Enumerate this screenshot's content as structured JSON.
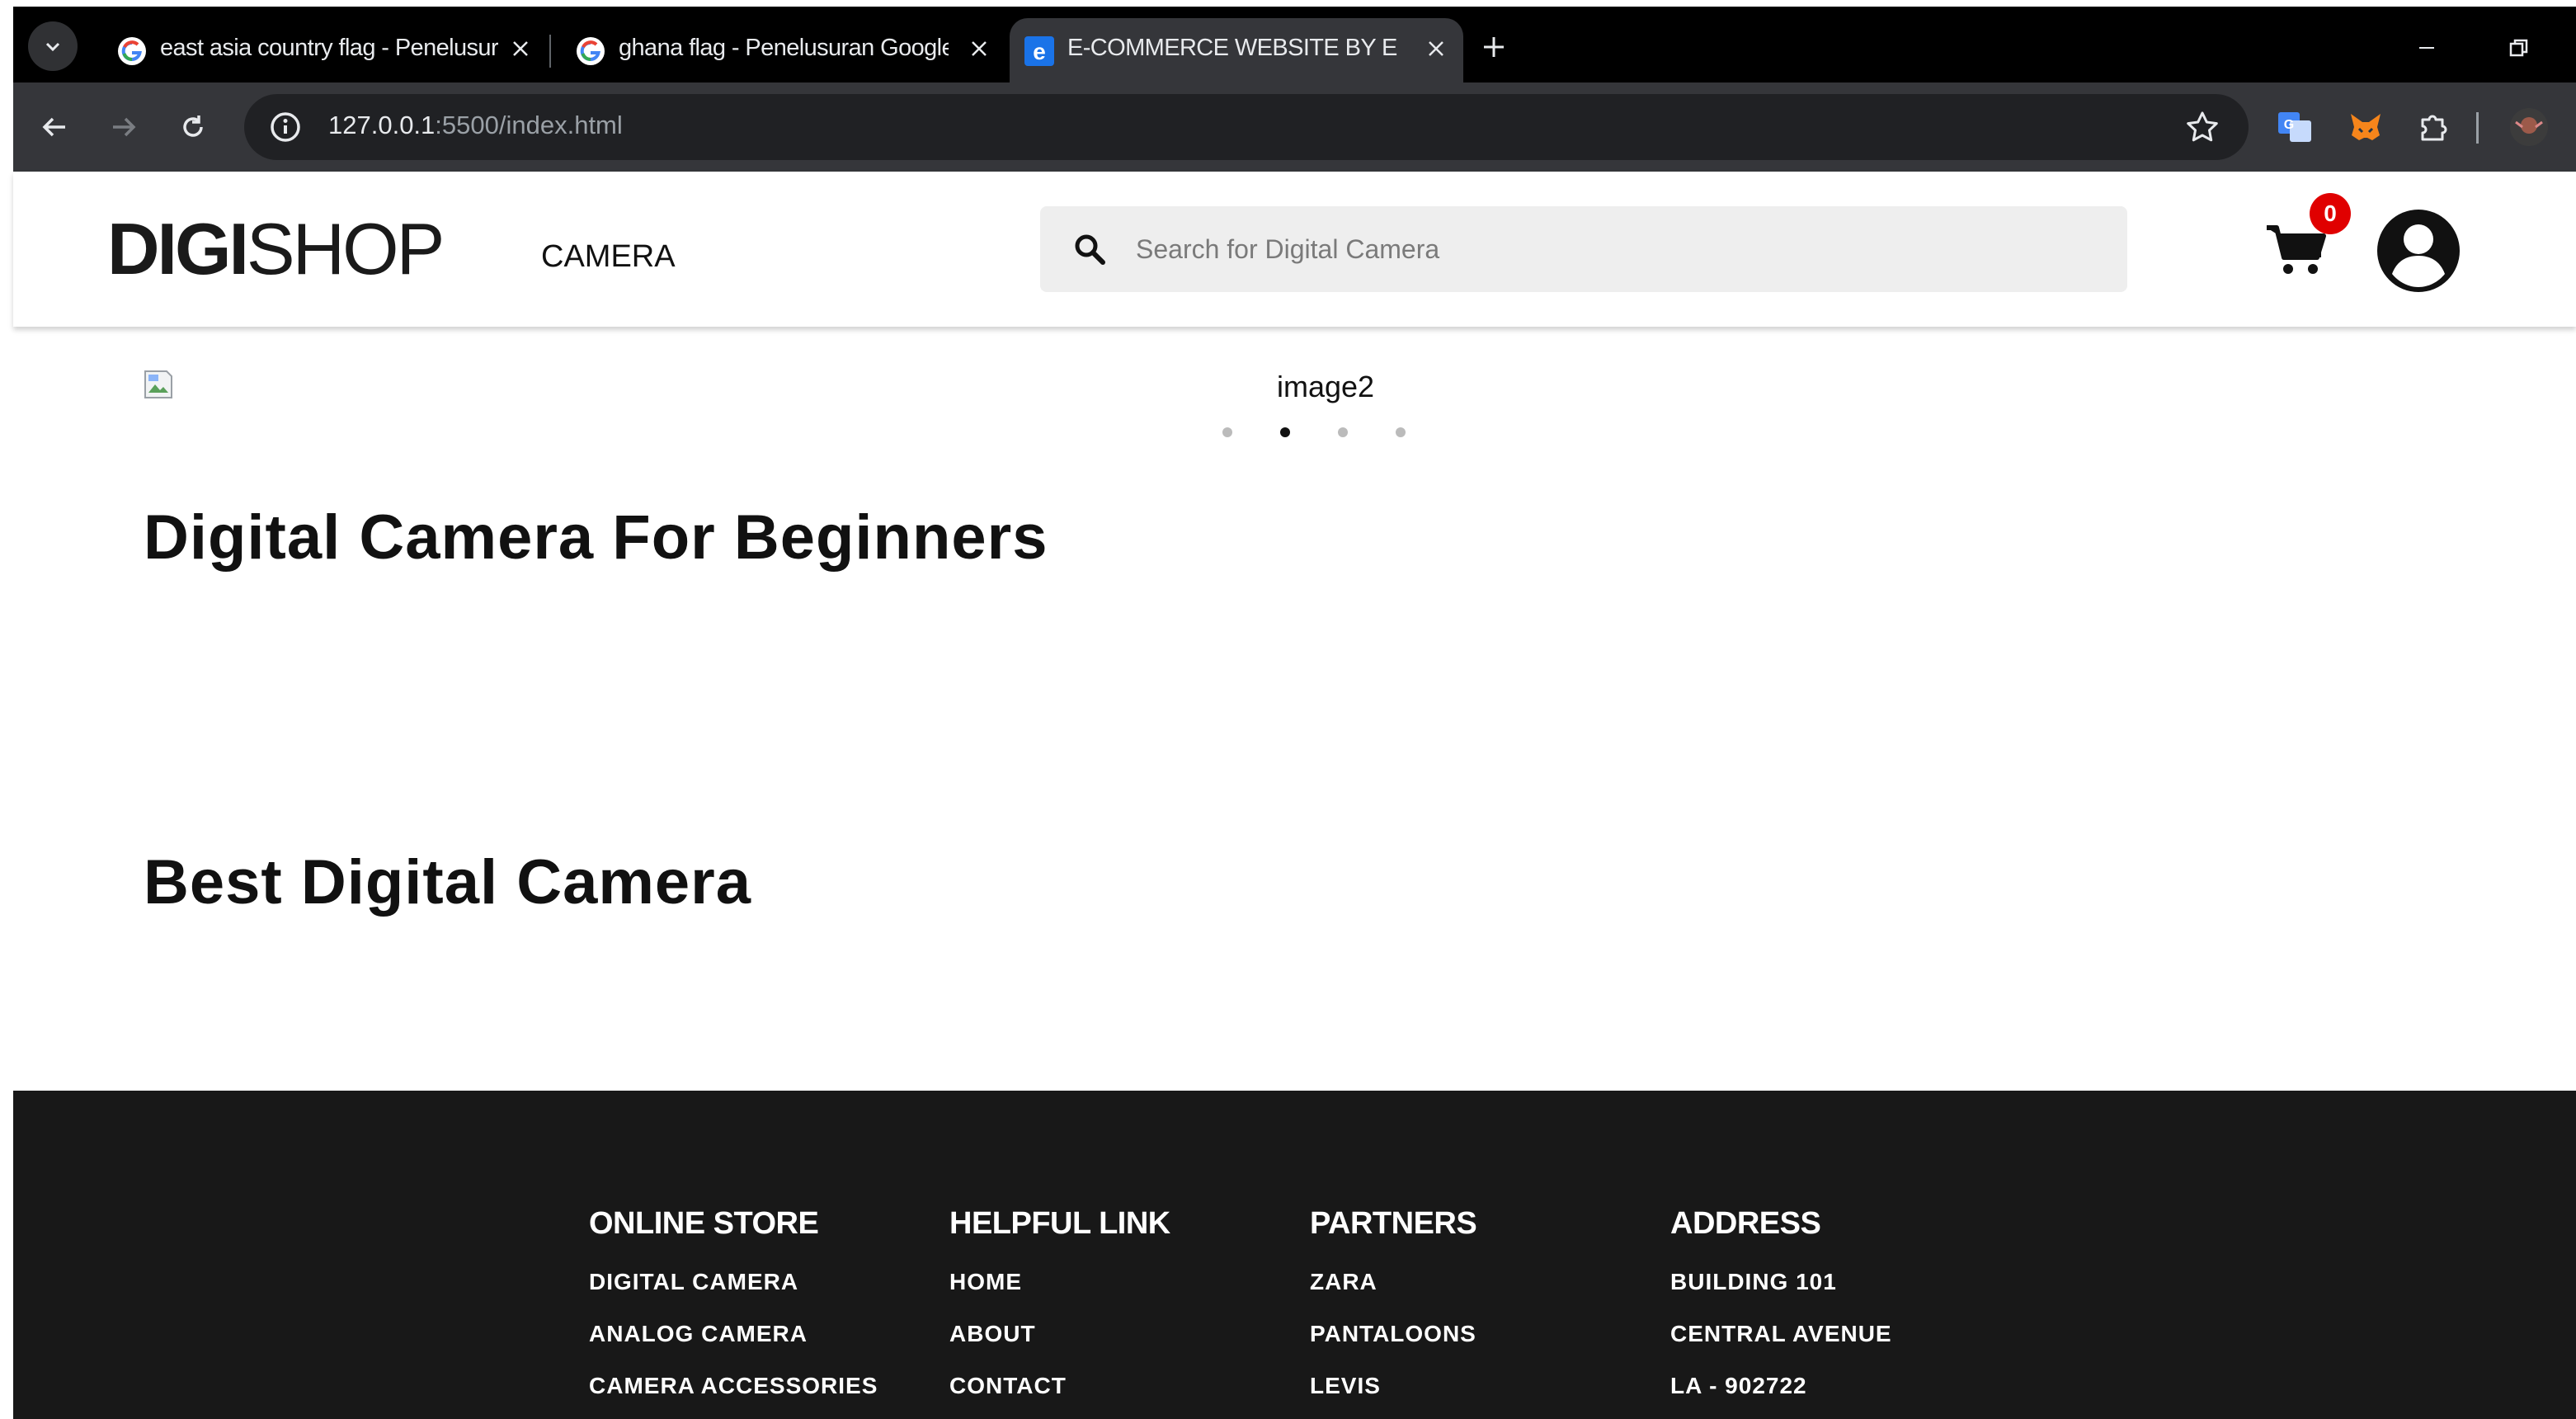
{
  "browser": {
    "tabs": [
      {
        "title": "east asia country flag - Penelusuran Google"
      },
      {
        "title": "ghana flag - Penelusuran Google"
      },
      {
        "title": "E-COMMERCE WEBSITE BY EDY"
      }
    ],
    "url_host": "127.0.0.1",
    "url_rest": ":5500/index.html"
  },
  "header": {
    "logo_bold": "DIGI",
    "logo_light": "SHOP",
    "nav_label": "CAMERA",
    "search_placeholder": "Search for Digital Camera",
    "cart_count": "0"
  },
  "slider": {
    "label": "image2",
    "dot_count": 4,
    "active_index": 1
  },
  "sections": [
    {
      "title": "Digital Camera For Beginners"
    },
    {
      "title": "Best Digital Camera"
    }
  ],
  "footer": {
    "columns": [
      {
        "heading": "ONLINE STORE",
        "links": [
          "DIGITAL CAMERA",
          "ANALOG CAMERA",
          "CAMERA ACCESSORIES"
        ]
      },
      {
        "heading": "HELPFUL LINK",
        "links": [
          "HOME",
          "ABOUT",
          "CONTACT"
        ]
      },
      {
        "heading": "PARTNERS",
        "links": [
          "ZARA",
          "PANTALOONS",
          "LEVIS"
        ]
      },
      {
        "heading": "ADDRESS",
        "links": [
          "BUILDING 101",
          "CENTRAL AVENUE",
          "LA - 902722"
        ]
      }
    ]
  }
}
